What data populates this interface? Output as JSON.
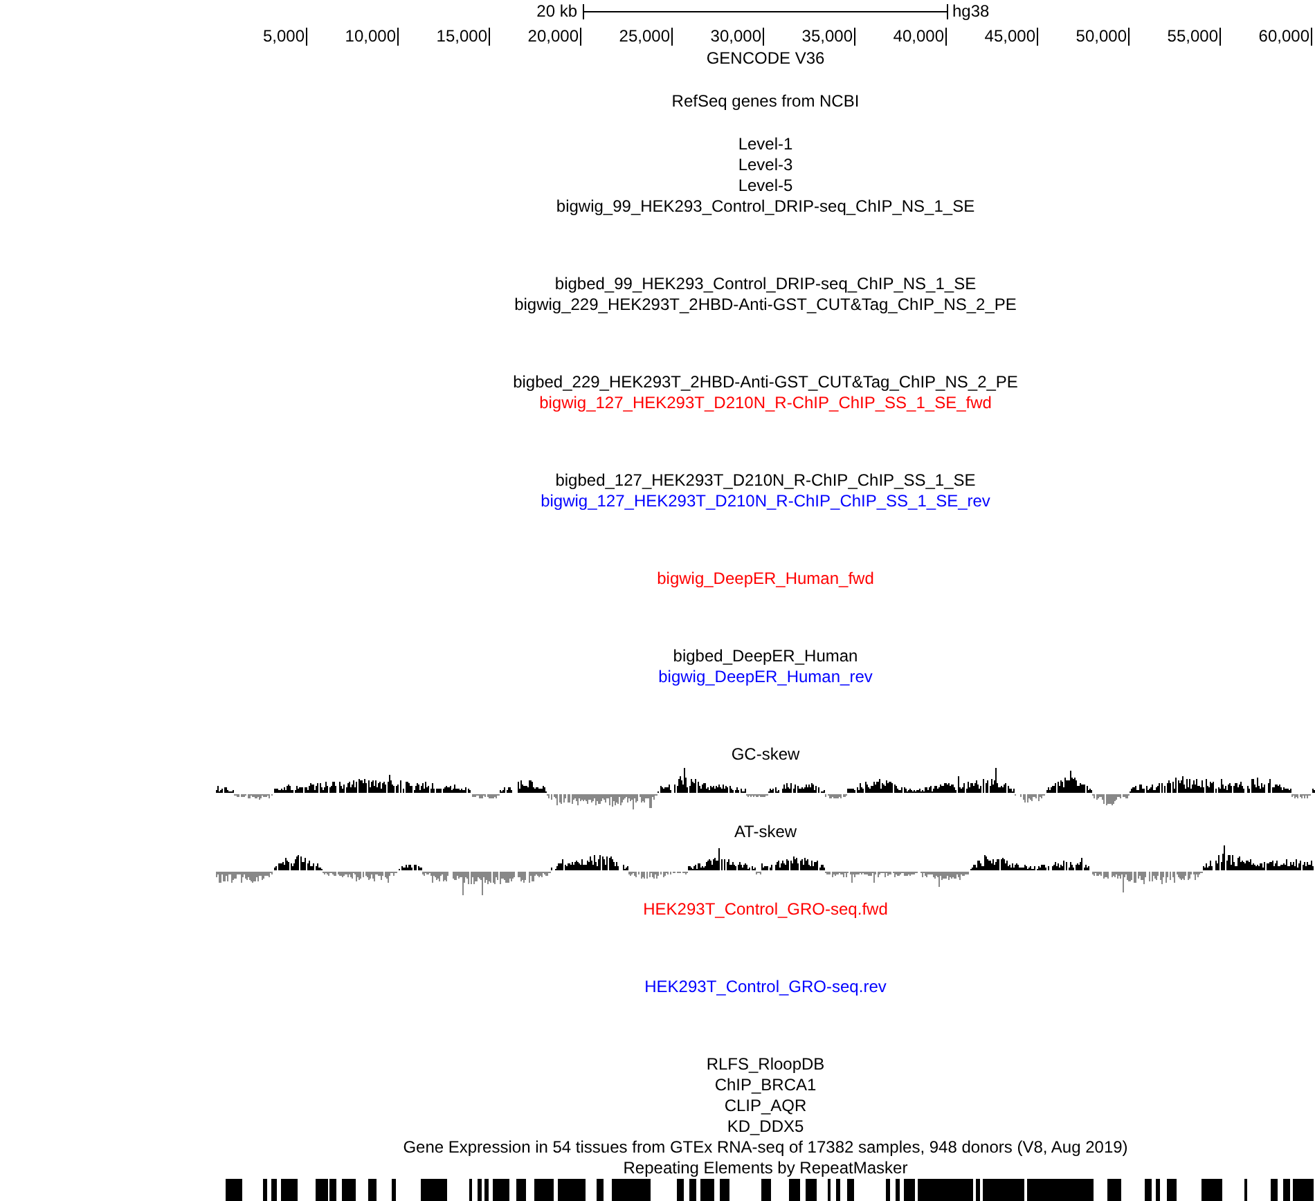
{
  "ruler": {
    "scale_label": "20 kb",
    "assembly": "hg38",
    "positions": [
      "5,000",
      "10,000",
      "15,000",
      "20,000",
      "25,000",
      "30,000",
      "35,000",
      "40,000",
      "45,000",
      "50,000",
      "55,000",
      "60,000"
    ]
  },
  "tracks": [
    {
      "label": "GENCODE V36",
      "kind": "genes",
      "color": "#000000"
    },
    {
      "label": "RefSeq genes from NCBI",
      "kind": "genes",
      "color": "#000000"
    },
    {
      "label": "Level-1",
      "kind": "bed",
      "color": "#000000"
    },
    {
      "label": "Level-3",
      "kind": "bed",
      "color": "#000000"
    },
    {
      "label": "Level-5",
      "kind": "bed",
      "color": "#000000"
    },
    {
      "label": "bigwig_99_HEK293_Control_DRIP-seq_ChIP_NS_1_SE",
      "kind": "wiggle",
      "color": "#000000"
    },
    {
      "label": "bigbed_99_HEK293_Control_DRIP-seq_ChIP_NS_1_SE",
      "kind": "bed",
      "color": "#000000"
    },
    {
      "label": "bigwig_229_HEK293T_2HBD-Anti-GST_CUT&Tag_ChIP_NS_2_PE",
      "kind": "wiggle",
      "color": "#000000"
    },
    {
      "label": "bigbed_229_HEK293T_2HBD-Anti-GST_CUT&Tag_ChIP_NS_2_PE",
      "kind": "bed",
      "color": "#000000"
    },
    {
      "label": "bigwig_127_HEK293T_D210N_R-ChIP_ChIP_SS_1_SE_fwd",
      "kind": "wiggle",
      "color": "#ff0000"
    },
    {
      "label": "bigbed_127_HEK293T_D210N_R-ChIP_ChIP_SS_1_SE",
      "kind": "bed",
      "color": "#000000"
    },
    {
      "label": "bigwig_127_HEK293T_D210N_R-ChIP_ChIP_SS_1_SE_rev",
      "kind": "wiggle",
      "color": "#0000ff"
    },
    {
      "label": "bigwig_DeepER_Human_fwd",
      "kind": "wiggle",
      "color": "#ff0000"
    },
    {
      "label": "bigbed_DeepER_Human",
      "kind": "bed",
      "color": "#000000"
    },
    {
      "label": "bigwig_DeepER_Human_rev",
      "kind": "wiggle",
      "color": "#0000ff"
    },
    {
      "label": "GC-skew",
      "kind": "skew",
      "color": "#000000"
    },
    {
      "label": "AT-skew",
      "kind": "skew",
      "color": "#000000"
    },
    {
      "label": "HEK293T_Control_GRO-seq.fwd",
      "kind": "wiggle",
      "color": "#ff0000"
    },
    {
      "label": "HEK293T_Control_GRO-seq.rev",
      "kind": "wiggle",
      "color": "#0000ff"
    },
    {
      "label": "RLFS_RloopDB",
      "kind": "bed",
      "color": "#000000"
    },
    {
      "label": "ChIP_BRCA1",
      "kind": "bed",
      "color": "#000000"
    },
    {
      "label": "CLIP_AQR",
      "kind": "bed",
      "color": "#000000"
    },
    {
      "label": "KD_DDX5",
      "kind": "bed",
      "color": "#000000"
    },
    {
      "label": "Gene Expression in 54 tissues from GTEx RNA-seq of 17382 samples, 948 donors (V8, Aug 2019)",
      "kind": "bed",
      "color": "#000000"
    },
    {
      "label": "Repeating Elements by RepeatMasker",
      "kind": "repeats",
      "color": "#000000"
    }
  ]
}
